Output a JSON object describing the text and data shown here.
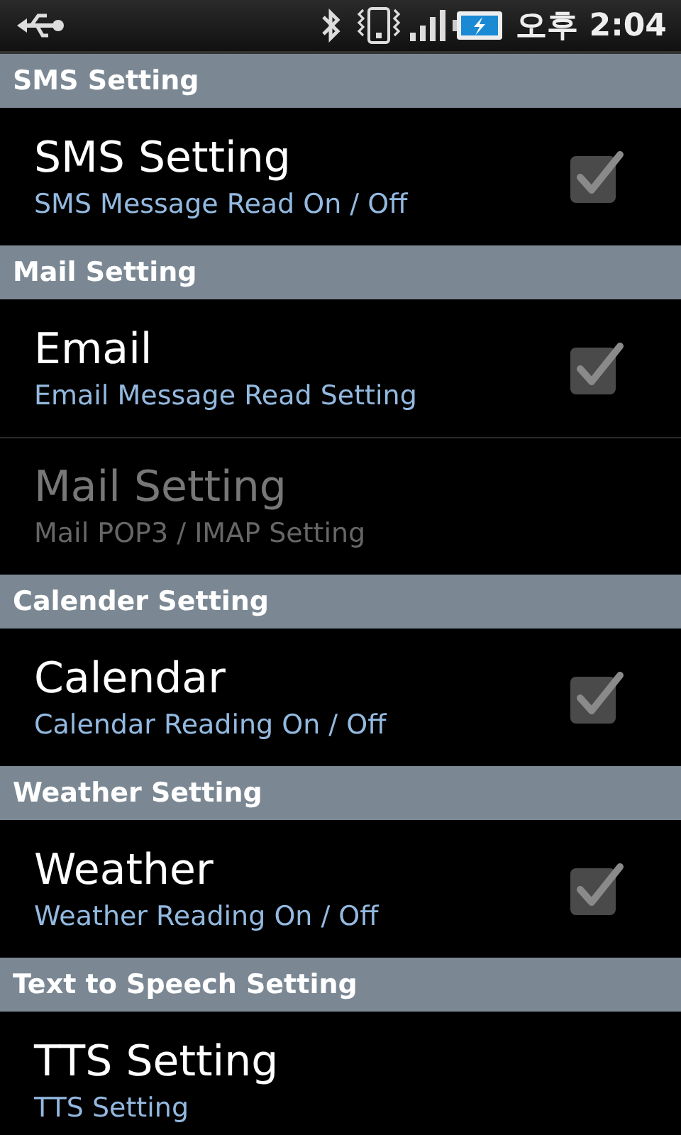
{
  "status_bar": {
    "time": "오후 2:04"
  },
  "sections": [
    {
      "title": "SMS Setting",
      "items": [
        {
          "kind": "checkbox",
          "title": "SMS Setting",
          "summary": "SMS Message Read On / Off",
          "checked": true,
          "disabled": false
        }
      ]
    },
    {
      "title": "Mail Setting",
      "items": [
        {
          "kind": "checkbox",
          "title": "Email",
          "summary": "Email Message Read Setting",
          "checked": true,
          "disabled": false
        },
        {
          "kind": "plain",
          "title": "Mail Setting",
          "summary": "Mail POP3 / IMAP Setting",
          "disabled": true
        }
      ]
    },
    {
      "title": "Calender Setting",
      "items": [
        {
          "kind": "checkbox",
          "title": "Calendar",
          "summary": "Calendar Reading On / Off",
          "checked": true,
          "disabled": false
        }
      ]
    },
    {
      "title": "Weather Setting",
      "items": [
        {
          "kind": "checkbox",
          "title": "Weather",
          "summary": "Weather Reading On / Off",
          "checked": true,
          "disabled": false
        }
      ]
    },
    {
      "title": "Text to Speech Setting",
      "items": [
        {
          "kind": "plain",
          "title": "TTS Setting",
          "summary": "TTS Setting",
          "disabled": false
        }
      ]
    }
  ]
}
